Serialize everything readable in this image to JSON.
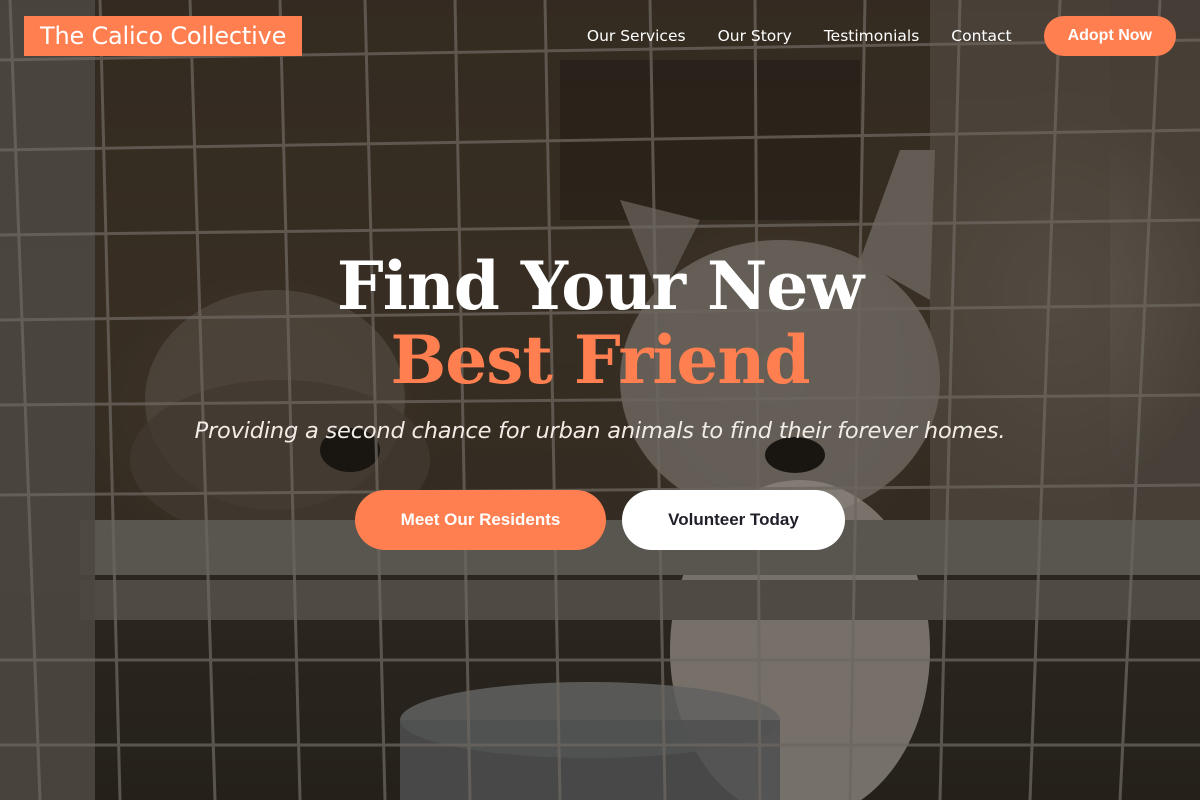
{
  "brand": {
    "name": "The Calico Collective"
  },
  "nav": {
    "items": [
      "Our Services",
      "Our Story",
      "Testimonials",
      "Contact"
    ],
    "cta_label": "Adopt Now"
  },
  "hero": {
    "headline_line1": "Find Your New",
    "headline_line2": "Best Friend",
    "subtitle": "Providing a second chance for urban animals to find their forever homes.",
    "primary_button": "Meet Our Residents",
    "secondary_button": "Volunteer Today",
    "background_image": "dogs-behind-wire-cage-photo"
  },
  "colors": {
    "accent": "#ff7f50",
    "white": "#ffffff",
    "dark_text": "#1f1f2a"
  }
}
